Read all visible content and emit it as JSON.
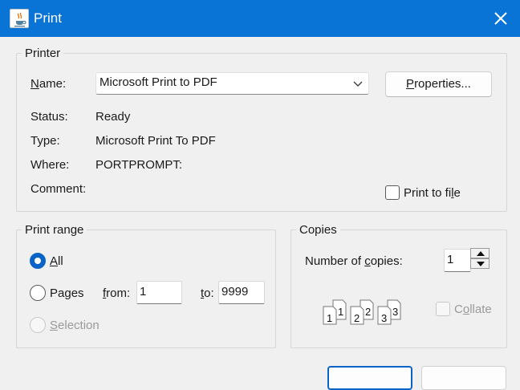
{
  "window": {
    "title": "Print"
  },
  "printer": {
    "legend": "Printer",
    "name_label": "Name:",
    "name_value": "Microsoft Print to PDF",
    "properties_button": "Properties...",
    "status_label": "Status:",
    "status_value": "Ready",
    "type_label": "Type:",
    "type_value": "Microsoft Print To PDF",
    "where_label": "Where:",
    "where_value": "PORTPROMPT:",
    "comment_label": "Comment:",
    "print_to_file_label": "Print to file"
  },
  "print_range": {
    "legend": "Print range",
    "all_label": "All",
    "pages_label": "Pages",
    "from_label": "from:",
    "from_value": "1",
    "to_label": "to:",
    "to_value": "9999",
    "selection_label": "Selection",
    "selected": "All"
  },
  "copies": {
    "legend": "Copies",
    "number_label": "Number of copies:",
    "number_value": "1",
    "collate_label": "Collate",
    "collate_checked": false,
    "collate_icon_labels": [
      "1",
      "1",
      "2",
      "2",
      "3",
      "3"
    ]
  },
  "colors": {
    "titlebar": "#0a74d6",
    "accent": "#0a64c8",
    "background": "#f0f0f0"
  }
}
